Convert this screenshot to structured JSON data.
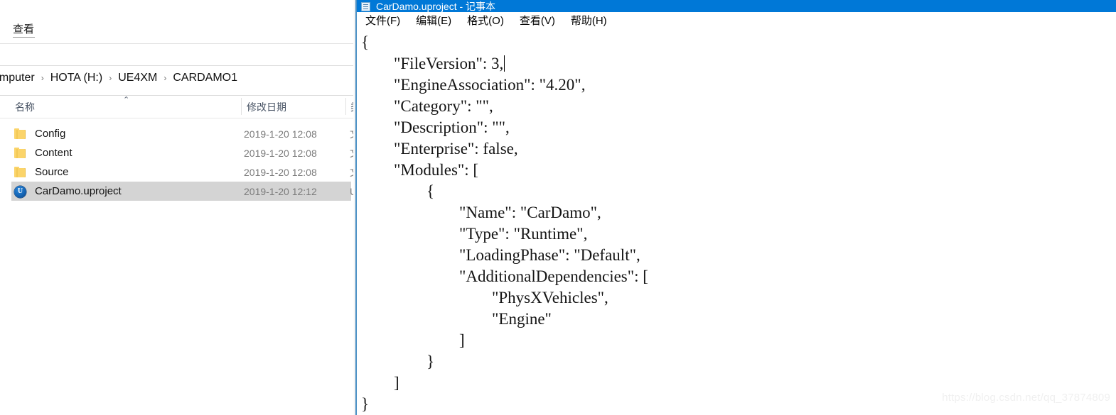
{
  "explorer": {
    "ribbon_tabs": [
      {
        "label": "查看"
      }
    ],
    "breadcrumb": {
      "items": [
        "omputer",
        "HOTA (H:)",
        "UE4XM",
        "CARDAMO1"
      ],
      "separator": "›"
    },
    "columns": {
      "name": "名称",
      "date_modified": "修改日期",
      "type": "类",
      "sort_caret": "⌃"
    },
    "files": [
      {
        "icon": "folder-icon",
        "name": "Config",
        "date": "2019-1-20 12:08",
        "type": "文",
        "selected": false
      },
      {
        "icon": "folder-icon",
        "name": "Content",
        "date": "2019-1-20 12:08",
        "type": "文",
        "selected": false
      },
      {
        "icon": "folder-icon",
        "name": "Source",
        "date": "2019-1-20 12:08",
        "type": "文",
        "selected": false
      },
      {
        "icon": "unreal-icon",
        "name": "CarDamo.uproject",
        "date": "2019-1-20 12:12",
        "type": "U",
        "selected": true
      }
    ]
  },
  "notepad": {
    "title": "CarDamo.uproject - 记事本",
    "title_icon": "notepad-icon",
    "menu": [
      {
        "label": "文件(F)"
      },
      {
        "label": "编辑(E)"
      },
      {
        "label": "格式(O)"
      },
      {
        "label": "查看(V)"
      },
      {
        "label": "帮助(H)"
      }
    ],
    "content_before_caret": "{\n\t\"FileVersion\": 3,",
    "content_after_caret": "\n\t\"EngineAssociation\": \"4.20\",\n\t\"Category\": \"\",\n\t\"Description\": \"\",\n\t\"Enterprise\": false,\n\t\"Modules\": [\n\t\t{\n\t\t\t\"Name\": \"CarDamo\",\n\t\t\t\"Type\": \"Runtime\",\n\t\t\t\"LoadingPhase\": \"Default\",\n\t\t\t\"AdditionalDependencies\": [\n\t\t\t\t\"PhysXVehicles\",\n\t\t\t\t\"Engine\"\n\t\t\t]\n\t\t}\n\t]\n}"
  },
  "watermark": {
    "text": "https://blog.csdn.net/qq_37874809"
  },
  "colors": {
    "titlebar_blue": "#0078d7",
    "window_border_blue": "#4a90c4",
    "selection_gray": "#d4d4d4",
    "folder_yellow": "#fbd46a",
    "unreal_blue": "#1565b5"
  }
}
